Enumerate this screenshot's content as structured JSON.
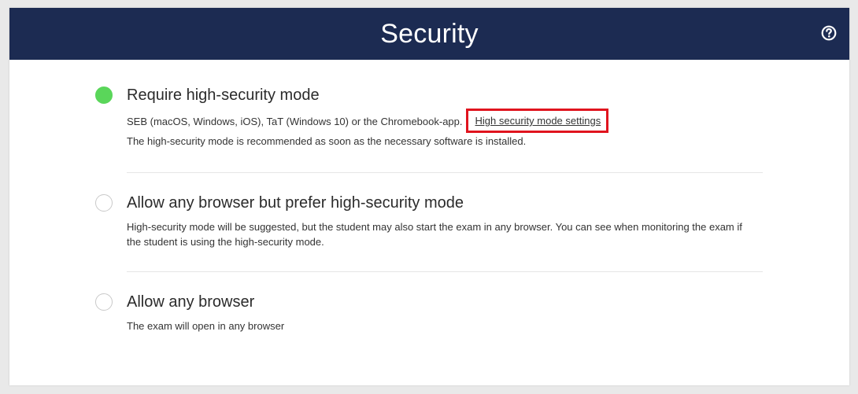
{
  "header": {
    "title": "Security",
    "help_icon": "question-circle-icon"
  },
  "options": [
    {
      "title": "Require high-security mode",
      "selected": true,
      "desc_line1": "SEB (macOS, Windows, iOS), TaT (Windows 10) or the Chromebook-app.",
      "link_label": "High security mode settings",
      "desc_line2": "The high-security mode is recommended as soon as the necessary software is installed."
    },
    {
      "title": "Allow any browser but prefer high-security mode",
      "selected": false,
      "desc": "High-security mode will be suggested, but the student may also start the exam in any browser. You can see when monitoring the exam if the student is using the high-security mode."
    },
    {
      "title": "Allow any browser",
      "selected": false,
      "desc": "The exam will open in any browser"
    }
  ],
  "colors": {
    "header_bg": "#1c2b52",
    "selected_radio": "#5ad65a",
    "highlight_box": "#e0141e"
  }
}
